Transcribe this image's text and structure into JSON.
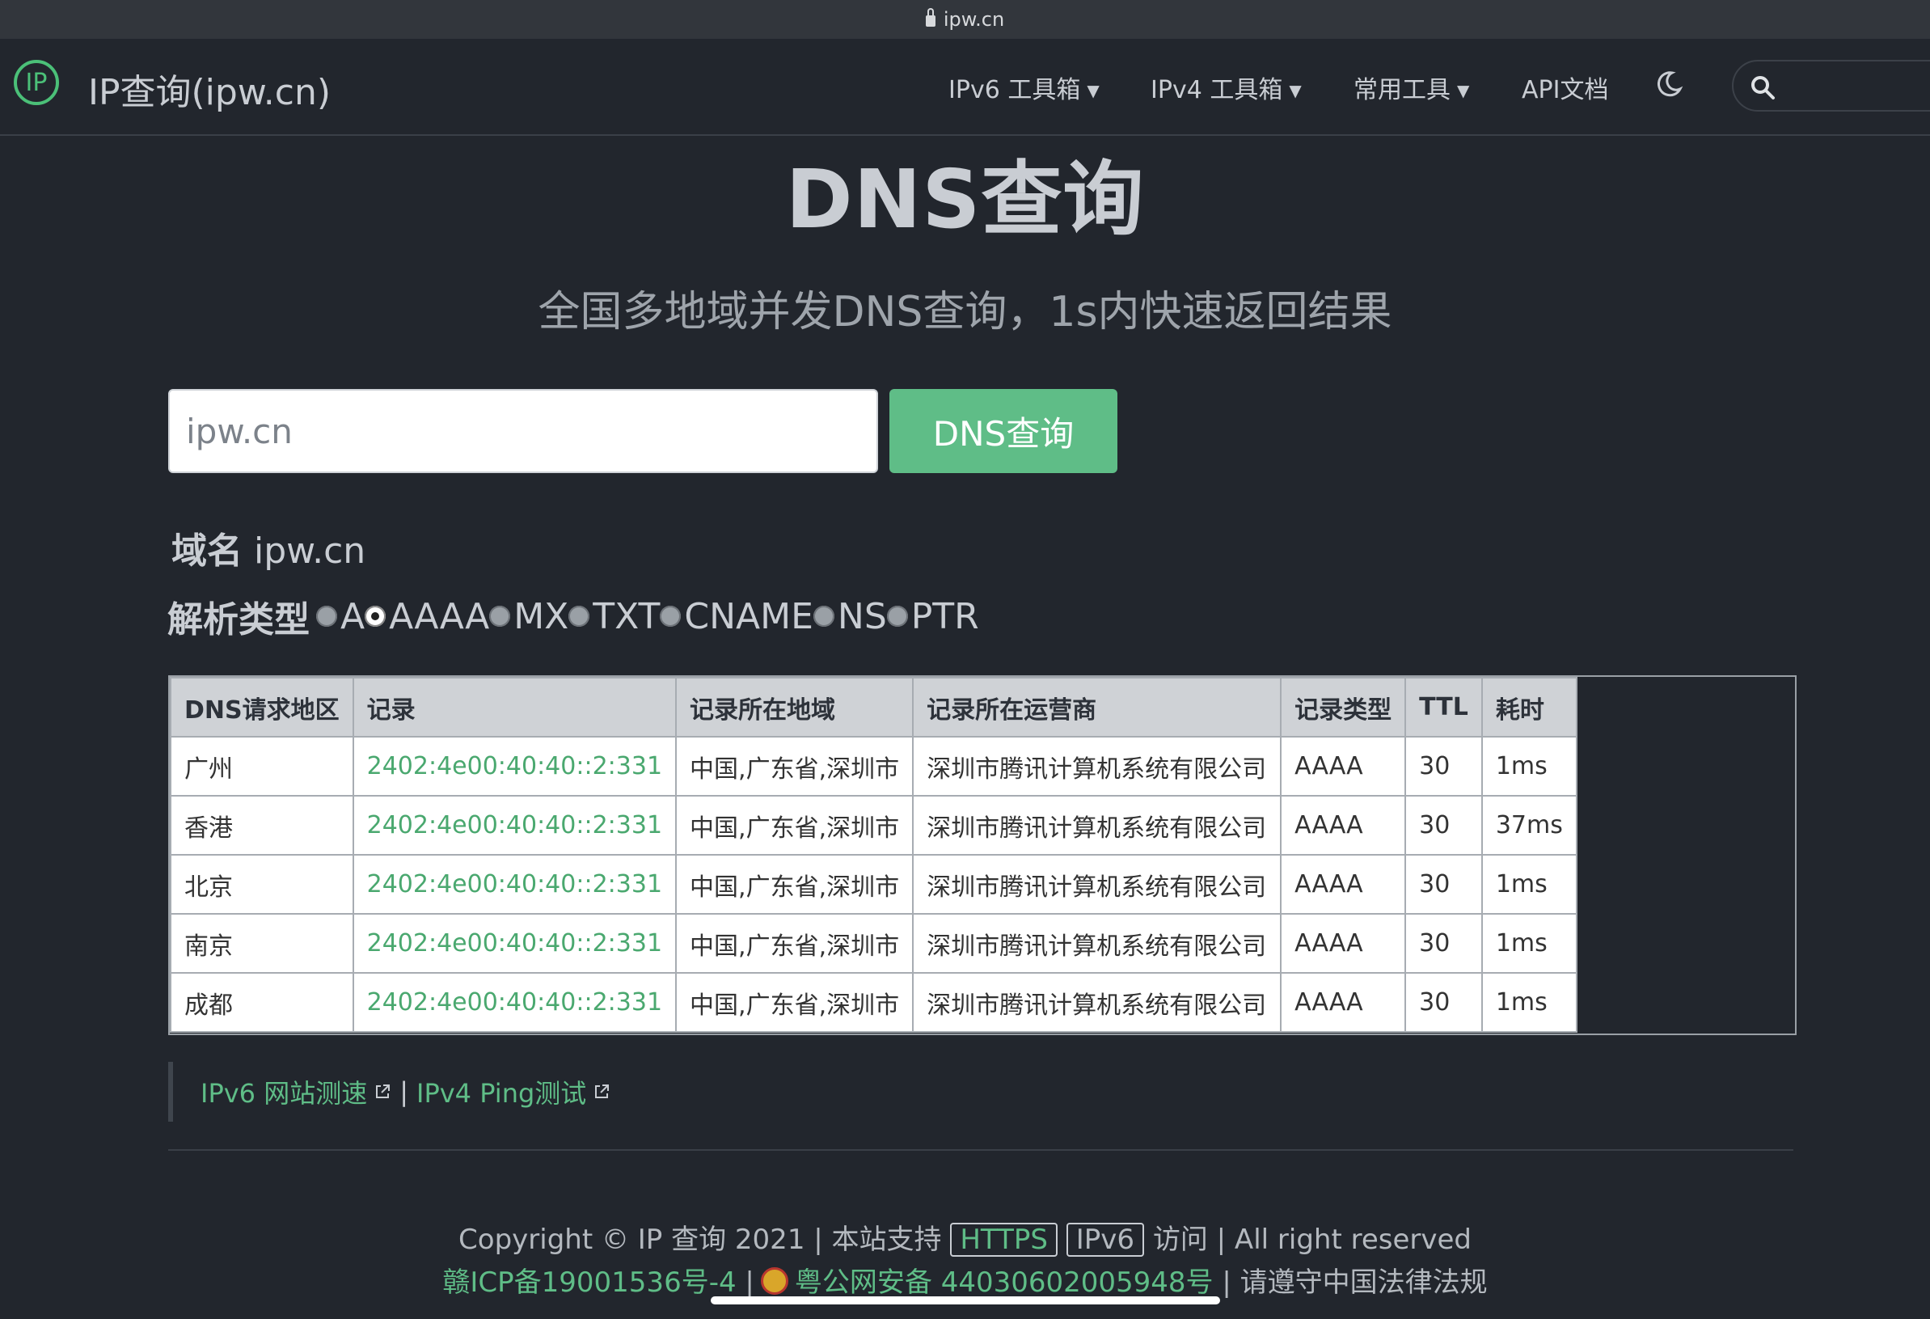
{
  "browser": {
    "url": "ipw.cn"
  },
  "header": {
    "logo_text": "IP",
    "site_title": "IP查询(ipw.cn)",
    "menu": [
      {
        "label": "IPv6 工具箱",
        "dropdown": true
      },
      {
        "label": "IPv4 工具箱",
        "dropdown": true
      },
      {
        "label": "常用工具",
        "dropdown": true
      },
      {
        "label": "API文档",
        "dropdown": false
      }
    ],
    "icons": [
      "moon-icon",
      "search-icon"
    ]
  },
  "main": {
    "title": "DNS查询",
    "subtitle": "全国多地域并发DNS查询，1s内快速返回结果",
    "input_value": "ipw.cn",
    "button_label": "DNS查询",
    "domain_label": "域名",
    "domain_value": "ipw.cn",
    "type_label": "解析类型",
    "types": [
      "A",
      "AAAA",
      "MX",
      "TXT",
      "CNAME",
      "NS",
      "PTR"
    ],
    "selected_type": "AAAA"
  },
  "table": {
    "headers": [
      "DNS请求地区",
      "记录",
      "记录所在地域",
      "记录所在运营商",
      "记录类型",
      "TTL",
      "耗时"
    ],
    "rows": [
      [
        "广州",
        "2402:4e00:40:40::2:331",
        "中国,广东省,深圳市",
        "深圳市腾讯计算机系统有限公司",
        "AAAA",
        "30",
        "1ms"
      ],
      [
        "香港",
        "2402:4e00:40:40::2:331",
        "中国,广东省,深圳市",
        "深圳市腾讯计算机系统有限公司",
        "AAAA",
        "30",
        "37ms"
      ],
      [
        "北京",
        "2402:4e00:40:40::2:331",
        "中国,广东省,深圳市",
        "深圳市腾讯计算机系统有限公司",
        "AAAA",
        "30",
        "1ms"
      ],
      [
        "南京",
        "2402:4e00:40:40::2:331",
        "中国,广东省,深圳市",
        "深圳市腾讯计算机系统有限公司",
        "AAAA",
        "30",
        "1ms"
      ],
      [
        "成都",
        "2402:4e00:40:40::2:331",
        "中国,广东省,深圳市",
        "深圳市腾讯计算机系统有限公司",
        "AAAA",
        "30",
        "1ms"
      ]
    ]
  },
  "links": {
    "ipv6_speed": "IPv6 网站测速",
    "separator": "|",
    "ipv4_ping": "IPv4 Ping测试"
  },
  "footer": {
    "copyright": "Copyright © IP 查询 2021 | 本站支持",
    "https": "HTTPS",
    "ipv6": "IPv6",
    "tail": "访问 | All right reserved",
    "icp": "赣ICP备19001536号-4",
    "sep": "|",
    "police": "粤公网安备 44030602005948号",
    "law": "| 请遵守中国法律法规"
  },
  "colors": {
    "background": "#22262d",
    "accent": "#5fbd87",
    "text": "#c9cdd3"
  }
}
